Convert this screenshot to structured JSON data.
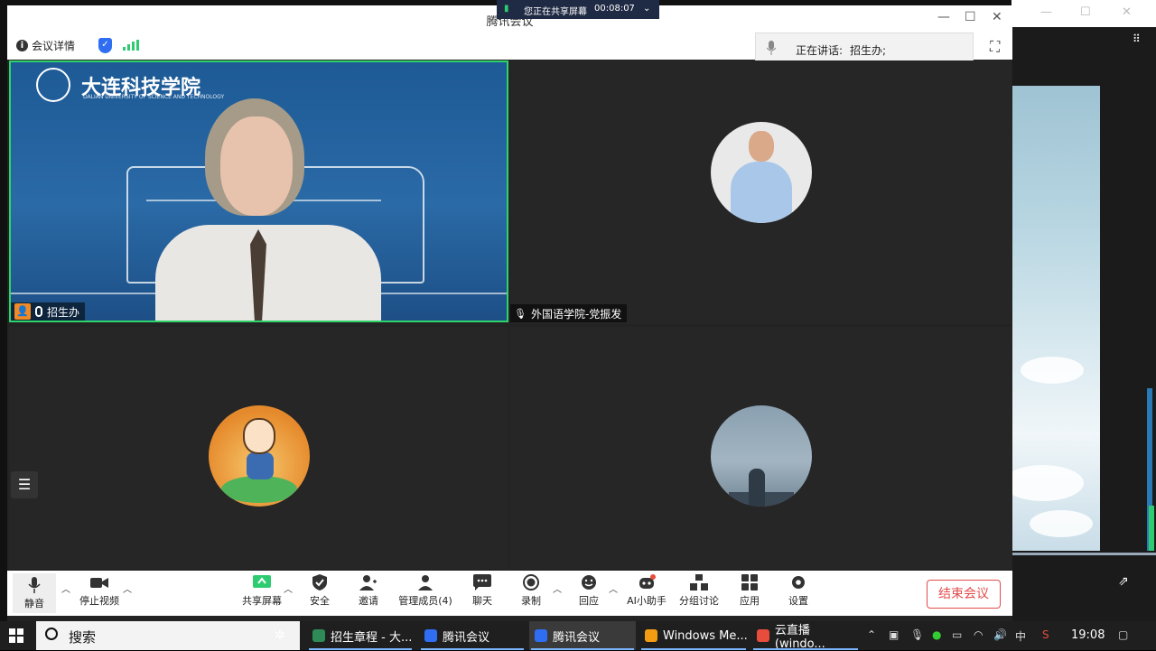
{
  "window": {
    "title": "腾讯会议",
    "info_label": "会议详情",
    "speaking_label": "正在讲话:",
    "speaking_name": "招生办;"
  },
  "share_banner": {
    "text": "您正在共享屏幕",
    "timer": "00:08:07"
  },
  "tiles": {
    "main_name": "招生办",
    "school_cn": "大连科技学院",
    "school_en": "DALIAN UNIVERSITY OF SCIENCE AND TECHNOLOGY",
    "tile2_name": "外国语学院-党振发"
  },
  "toolbar": {
    "mute": "静音",
    "stop_video": "停止视频",
    "share_screen": "共享屏幕",
    "security": "安全",
    "invite": "邀请",
    "manage_members": "管理成员(4)",
    "chat": "聊天",
    "record": "录制",
    "reply": "回应",
    "ai_assistant": "AI小助手",
    "breakout": "分组讨论",
    "apps": "应用",
    "settings": "设置",
    "end_meeting": "结束会议"
  },
  "taskbar": {
    "search_placeholder": "搜索",
    "apps": [
      {
        "label": "招生章程 - 大...",
        "color": "#2e8b57"
      },
      {
        "label": "腾讯会议",
        "color": "#2f6ef2"
      },
      {
        "label": "腾讯会议",
        "color": "#2f6ef2"
      },
      {
        "label": "Windows Me...",
        "color": "#f39c12"
      },
      {
        "label": "云直播(windo...",
        "color": "#e74c3c"
      }
    ],
    "ime": "中",
    "time": "19:08"
  },
  "colors": {
    "active_speaker_border": "#2ed36a",
    "end_meeting": "#e24b4b",
    "accent": "#2f6ef2"
  }
}
